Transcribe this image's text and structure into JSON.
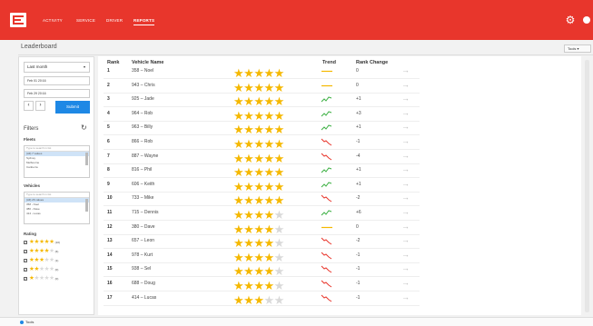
{
  "header": {
    "nav": [
      "ACTIVITY",
      "SERVICE",
      "DRIVER",
      "REPORTS"
    ],
    "active_index": 3,
    "accent": "#e8362c"
  },
  "page": {
    "title": "Leaderboard",
    "tools_label": "Tools ▾"
  },
  "sidebar": {
    "period": "Last month",
    "date_from": "Feb 01 20:16",
    "date_to": "Feb 29 20:16",
    "prev": "‹",
    "next": "›",
    "submit_label": "Submit",
    "filters_title": "Filters",
    "fleets": {
      "label": "Fleets",
      "placeholder": "Type to search in list",
      "items": [
        "(All) 7 values",
        "Sydney",
        "Melbourne",
        "Canberra"
      ]
    },
    "vehicles": {
      "label": "Vehicles",
      "placeholder": "Type to search in list",
      "items": [
        "(All) 26 values",
        "358 - Noel",
        "380 - Dave",
        "414 - Lucas"
      ]
    },
    "rating": {
      "label": "Rating",
      "rows": [
        {
          "stars": 5,
          "count": "(10)"
        },
        {
          "stars": 4,
          "count": "(6)"
        },
        {
          "stars": 3,
          "count": "(1)"
        },
        {
          "stars": 2,
          "count": "(0)"
        },
        {
          "stars": 1,
          "count": "(0)"
        }
      ]
    }
  },
  "table": {
    "headers": {
      "rank": "Rank",
      "vehicle": "Vehicle Name",
      "trend": "Trend",
      "change": "Rank Change"
    },
    "rows": [
      {
        "rank": "1",
        "vehicle": "358 – Noel",
        "stars": 5,
        "trend": "flat",
        "change": "0"
      },
      {
        "rank": "2",
        "vehicle": "943 – Chris",
        "stars": 5,
        "trend": "flat",
        "change": "0"
      },
      {
        "rank": "3",
        "vehicle": "925 – Jade",
        "stars": 5,
        "trend": "up",
        "change": "+1"
      },
      {
        "rank": "4",
        "vehicle": "964 – Rob",
        "stars": 5,
        "trend": "up",
        "change": "+3"
      },
      {
        "rank": "5",
        "vehicle": "963 – Billy",
        "stars": 5,
        "trend": "up",
        "change": "+1"
      },
      {
        "rank": "6",
        "vehicle": "866 – Rob",
        "stars": 5,
        "trend": "down",
        "change": "-1"
      },
      {
        "rank": "7",
        "vehicle": "887 – Wayne",
        "stars": 5,
        "trend": "down",
        "change": "-4"
      },
      {
        "rank": "8",
        "vehicle": "816 – Phil",
        "stars": 5,
        "trend": "up",
        "change": "+1"
      },
      {
        "rank": "9",
        "vehicle": "606 – Keith",
        "stars": 5,
        "trend": "up",
        "change": "+1"
      },
      {
        "rank": "10",
        "vehicle": "733 – Mike",
        "stars": 5,
        "trend": "down",
        "change": "-2"
      },
      {
        "rank": "11",
        "vehicle": "715 – Dennis",
        "stars": 4,
        "trend": "up",
        "change": "+6"
      },
      {
        "rank": "12",
        "vehicle": "380 – Dave",
        "stars": 4,
        "trend": "flat",
        "change": "0"
      },
      {
        "rank": "13",
        "vehicle": "657 – Leon",
        "stars": 4,
        "trend": "down",
        "change": "-2"
      },
      {
        "rank": "14",
        "vehicle": "978 – Kurt",
        "stars": 4,
        "trend": "down",
        "change": "-1"
      },
      {
        "rank": "15",
        "vehicle": "938 – Sel",
        "stars": 4,
        "trend": "down",
        "change": "-1"
      },
      {
        "rank": "16",
        "vehicle": "688 – Doug",
        "stars": 4,
        "trend": "down",
        "change": "-1"
      },
      {
        "rank": "17",
        "vehicle": "414 – Lucas",
        "stars": 3,
        "trend": "down",
        "change": "-1"
      }
    ]
  },
  "colors": {
    "star": "#f5b800",
    "star_empty": "#d9d9d9",
    "trend_up": "#3cb043",
    "trend_down": "#e8362c",
    "trend_flat": "#f5b800",
    "submit": "#1e88e5"
  },
  "footer": {
    "label": "Tools"
  }
}
